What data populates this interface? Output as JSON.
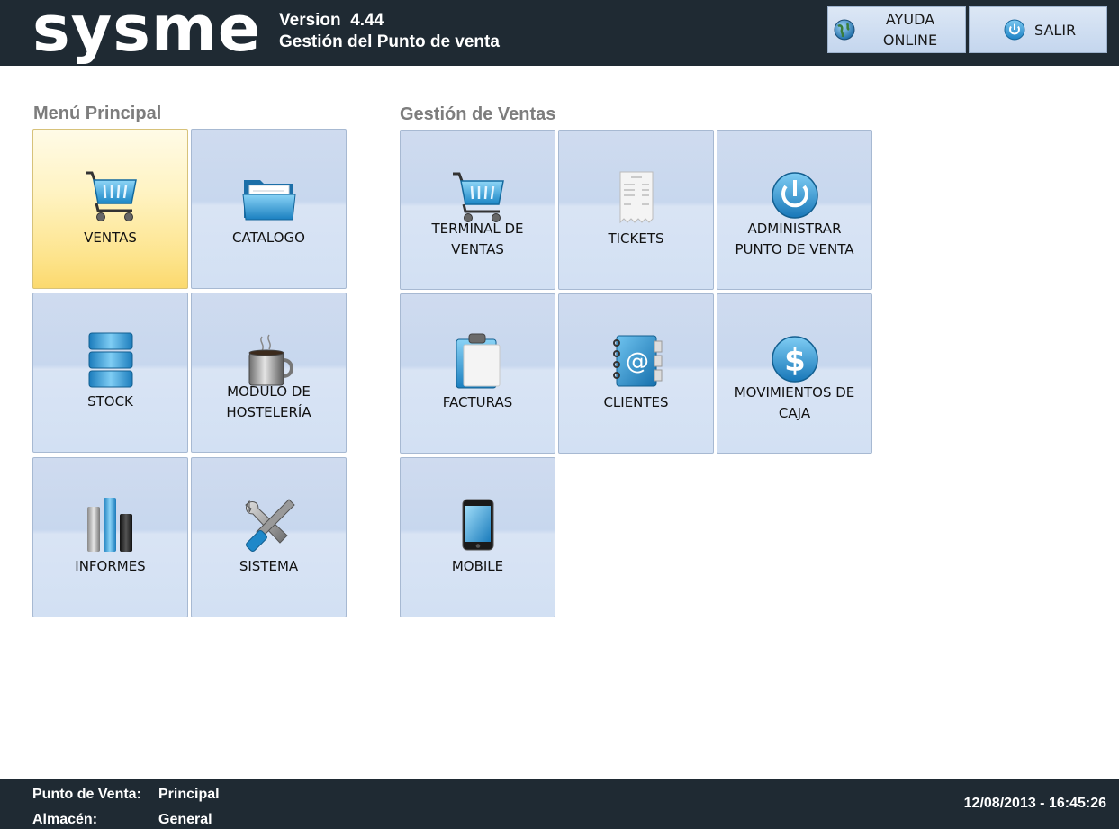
{
  "header": {
    "logo": "sysme",
    "version_line": "Version  4.44",
    "subtitle": "Gestión del Punto de venta",
    "help_button": "AYUDA\nONLINE",
    "exit_button": "SALIR"
  },
  "main_menu": {
    "title": "Menú Principal",
    "tiles": [
      {
        "label": "VENTAS",
        "icon": "shopping-cart-icon",
        "active": true
      },
      {
        "label": "CATALOGO",
        "icon": "folder-icon"
      },
      {
        "label": "STOCK",
        "icon": "database-icon"
      },
      {
        "label": "MODULO DE\nHOSTELERÍA",
        "icon": "coffee-cup-icon"
      },
      {
        "label": "INFORMES",
        "icon": "bar-chart-icon"
      },
      {
        "label": "SISTEMA",
        "icon": "tools-icon"
      }
    ]
  },
  "sales_menu": {
    "title": "Gestión de Ventas",
    "tiles": [
      {
        "label": "TERMINAL DE\nVENTAS",
        "icon": "shopping-cart-icon"
      },
      {
        "label": "TICKETS",
        "icon": "receipt-icon"
      },
      {
        "label": "ADMINISTRAR\nPUNTO DE VENTA",
        "icon": "power-icon"
      },
      {
        "label": "FACTURAS",
        "icon": "clipboard-icon"
      },
      {
        "label": "CLIENTES",
        "icon": "address-book-icon"
      },
      {
        "label": "MOVIMIENTOS DE\nCAJA",
        "icon": "dollar-icon"
      },
      {
        "label": "MOBILE",
        "icon": "smartphone-icon"
      }
    ]
  },
  "footer": {
    "pos_label": "Punto de Venta:",
    "pos_value": "Principal",
    "warehouse_label": "Almacén:",
    "warehouse_value": "General",
    "datetime": "12/08/2013 - 16:45:26"
  },
  "colors": {
    "header_bg": "#1f2a33",
    "tile_bg": "#cfdbef",
    "active_tile_bg": "#fde48d",
    "section_title": "#7d7d7d"
  }
}
